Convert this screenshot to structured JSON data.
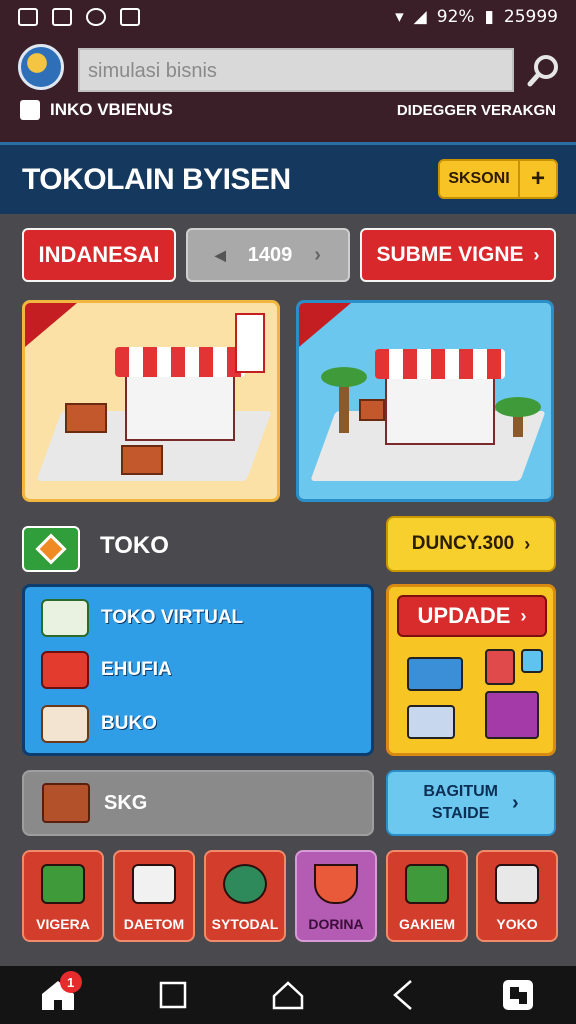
{
  "status_bar": {
    "battery": "92%",
    "time": "25999"
  },
  "header": {
    "search_placeholder": "simulasi bisnis",
    "account_label": "INKO VBIENUS",
    "right_link": "DIDEGGER VERAKGN"
  },
  "title_band": {
    "title": "TOKOLAIN BYISEN",
    "season_label": "SKSONI",
    "plus_label": "+"
  },
  "controls": {
    "region_button": "INDANESAI",
    "pager_value": "1409",
    "pager_prev": "◀",
    "pager_next": "›",
    "subme_button": "SUBME VIGNE",
    "chevron": "›"
  },
  "cards": [
    {
      "name": "shop-card-market"
    },
    {
      "name": "shop-card-store"
    }
  ],
  "toko": {
    "label": "TOKO",
    "money": "DUNCY.300",
    "chevron": "›"
  },
  "menu": {
    "items": [
      {
        "label": "TOKO VIRTUAL",
        "icon": "worker-icon"
      },
      {
        "label": "EHUFIA",
        "icon": "cash-register-icon"
      },
      {
        "label": "BUKO",
        "icon": "truck-icon"
      }
    ]
  },
  "update": {
    "label": "UPDADE",
    "chevron": "›"
  },
  "skg": {
    "label": "SKG"
  },
  "strategy": {
    "line1": "BAGITUM",
    "line2": "STAIDE",
    "chevron": "›"
  },
  "tiles": [
    {
      "label": "VIGERA",
      "icon": "cash-box-icon",
      "color": "#d23d2c"
    },
    {
      "label": "DAETOM",
      "icon": "receipt-icon",
      "color": "#d23d2c"
    },
    {
      "label": "SYTODAL",
      "icon": "fruit-icon",
      "color": "#d23d2c"
    },
    {
      "label": "DORINA",
      "icon": "basket-icon",
      "color": "#b45bb3"
    },
    {
      "label": "GAKIEM",
      "icon": "crate-icon",
      "color": "#d23d2c"
    },
    {
      "label": "YOKO",
      "icon": "machine-icon",
      "color": "#d23d2c"
    }
  ],
  "nav": {
    "badge": "1"
  },
  "colors": {
    "accent_red": "#d8282b",
    "accent_yellow": "#f7c325",
    "panel_blue": "#2f9ee6",
    "title_blue": "#15385e"
  }
}
